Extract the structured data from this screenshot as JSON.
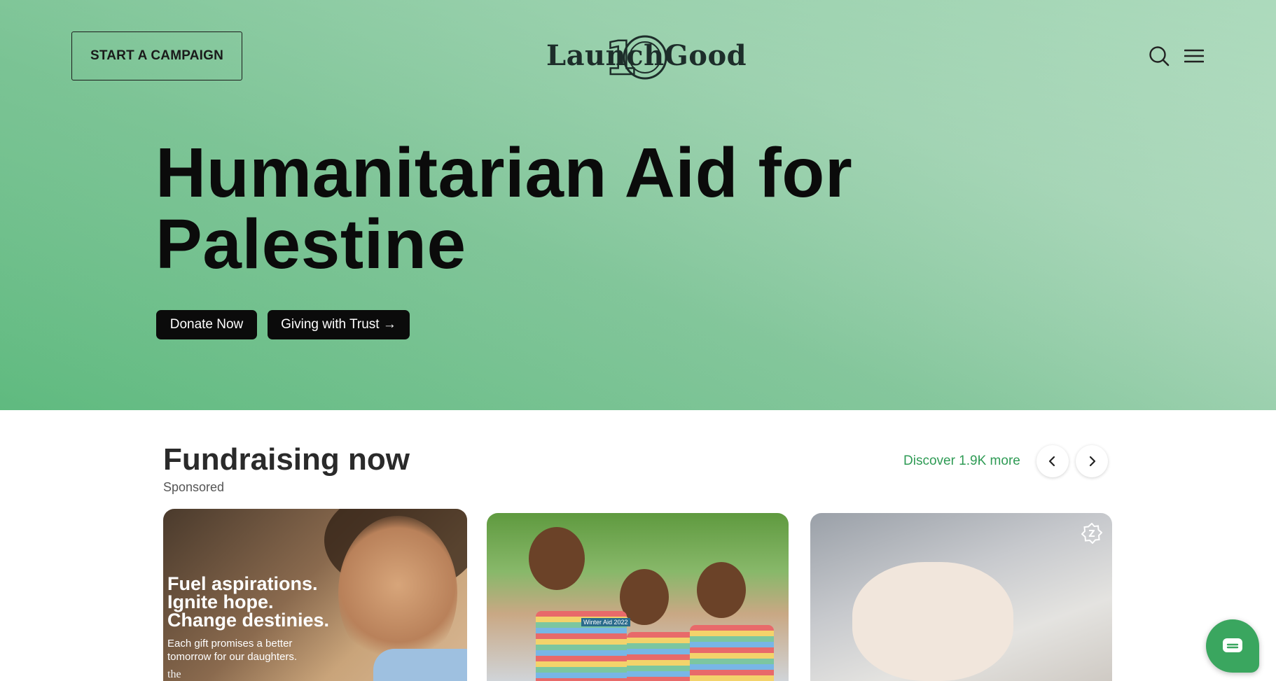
{
  "header": {
    "start_campaign_label": "START A CAMPAIGN",
    "logo_text": "LaunchGood",
    "logo_badge": "10",
    "search_icon": "search-icon",
    "menu_icon": "hamburger-menu-icon"
  },
  "hero": {
    "title": "Humanitarian Aid for Palestine",
    "donate_label": "Donate Now",
    "trust_label": "Giving with Trust →"
  },
  "fundraising": {
    "title": "Fundraising now",
    "subtitle": "Sponsored",
    "discover_label": "Discover 1.9K more",
    "prev_icon": "chevron-left-icon",
    "next_icon": "chevron-right-icon",
    "cards": [
      {
        "headline": "Fuel aspirations.\nIgnite hope.\nChange destinies.",
        "sub": "Each gift promises a better tomorrow for our daughters.",
        "logo_fragment": "the"
      },
      {
        "parcel_text": "Winter Aid 2022"
      },
      {
        "badge_icon": "zakat-badge-icon",
        "badge_letter": "Z"
      }
    ]
  },
  "chat": {
    "icon": "chat-icon"
  },
  "colors": {
    "accent": "#2f9b55",
    "hero_green": "#5fba7f",
    "button_dark": "#0b0b0b"
  }
}
